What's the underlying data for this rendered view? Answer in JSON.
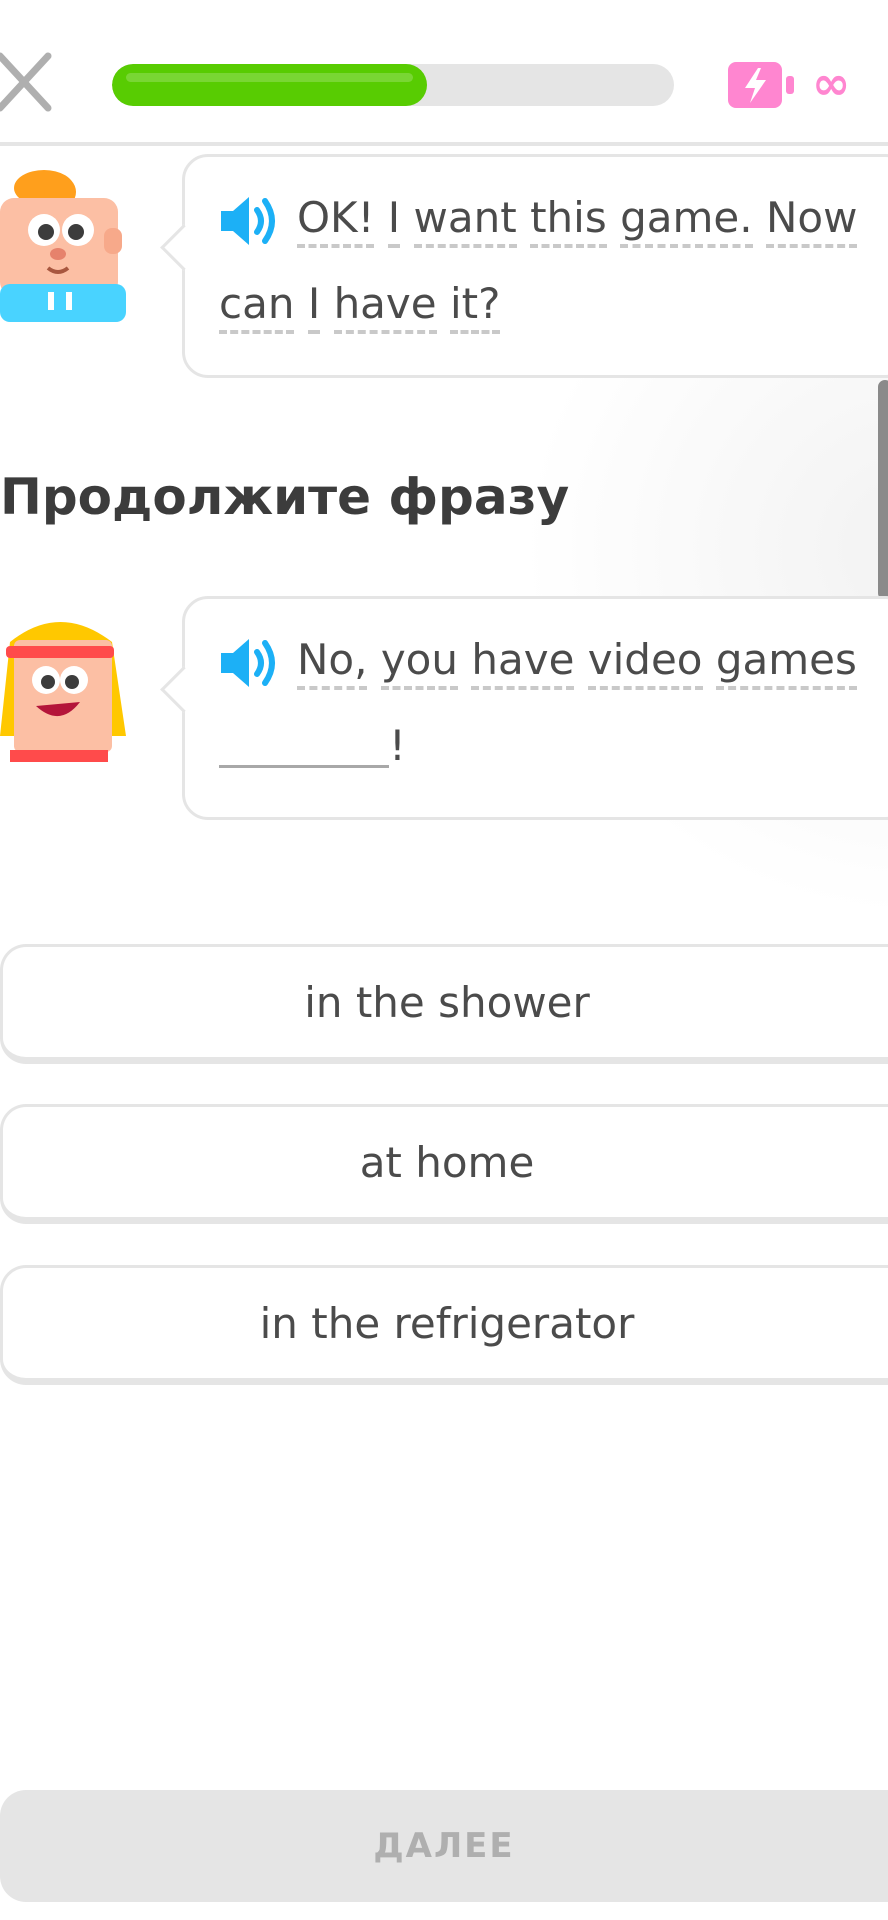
{
  "header": {
    "close_icon": "close-icon",
    "progress": 0.56,
    "energy_icon": "energy-battery-icon",
    "energy_value": "∞"
  },
  "dialog": {
    "prompt": {
      "speaker_icon": "speaker-icon",
      "line1_words": [
        "OK!",
        "I",
        "want",
        "this",
        "game.",
        "Now"
      ],
      "line2_words": [
        "can",
        "I",
        "have",
        "it?"
      ]
    },
    "instruction": "Продолжите фразу",
    "response": {
      "speaker_icon": "speaker-icon",
      "line1_words": [
        "No,",
        "you",
        "have",
        "video",
        "games"
      ],
      "after_blank": "!"
    }
  },
  "options": [
    {
      "label": "in the shower"
    },
    {
      "label": "at home"
    },
    {
      "label": "in the refrigerator"
    }
  ],
  "footer": {
    "continue_label": "ДАЛЕЕ"
  },
  "colors": {
    "progress_green": "#58cc02",
    "energy_pink": "#ff86d0",
    "speaker_blue": "#1cb0f6",
    "border_gray": "#e5e5e5"
  }
}
